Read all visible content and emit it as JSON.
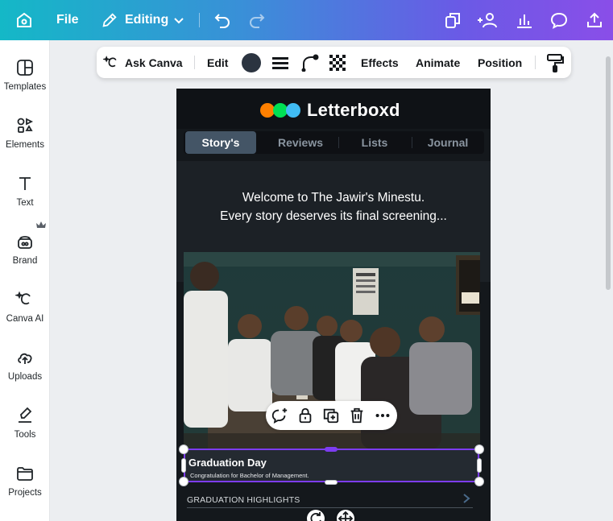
{
  "topbar": {
    "file_label": "File",
    "editing_label": "Editing"
  },
  "sidebar": {
    "items": [
      {
        "label": "Templates"
      },
      {
        "label": "Elements"
      },
      {
        "label": "Text"
      },
      {
        "label": "Brand"
      },
      {
        "label": "Canva AI"
      },
      {
        "label": "Uploads"
      },
      {
        "label": "Tools"
      },
      {
        "label": "Projects"
      }
    ]
  },
  "context_toolbar": {
    "ask_canva": "Ask Canva",
    "edit": "Edit",
    "effects": "Effects",
    "animate": "Animate",
    "position": "Position",
    "text_color": "#2b3440"
  },
  "design": {
    "brand_name": "Letterboxd",
    "logo_colors": [
      "#ff8000",
      "#00e054",
      "#40bcf4"
    ],
    "tabs": [
      {
        "label": "Story's",
        "active": true
      },
      {
        "label": "Reviews",
        "active": false
      },
      {
        "label": "Lists",
        "active": false
      },
      {
        "label": "Journal",
        "active": false
      }
    ],
    "welcome_line1": "Welcome to The Jawir's Minestu.",
    "welcome_line2": "Every story deserves its final screening...",
    "caption_title": "Graduation Day",
    "caption_subtitle": "Congratulation for Bachelor of Management.",
    "highlights_label": "GRADUATION HIGHLIGHTS"
  },
  "colors": {
    "selection": "#7d3cf0"
  }
}
